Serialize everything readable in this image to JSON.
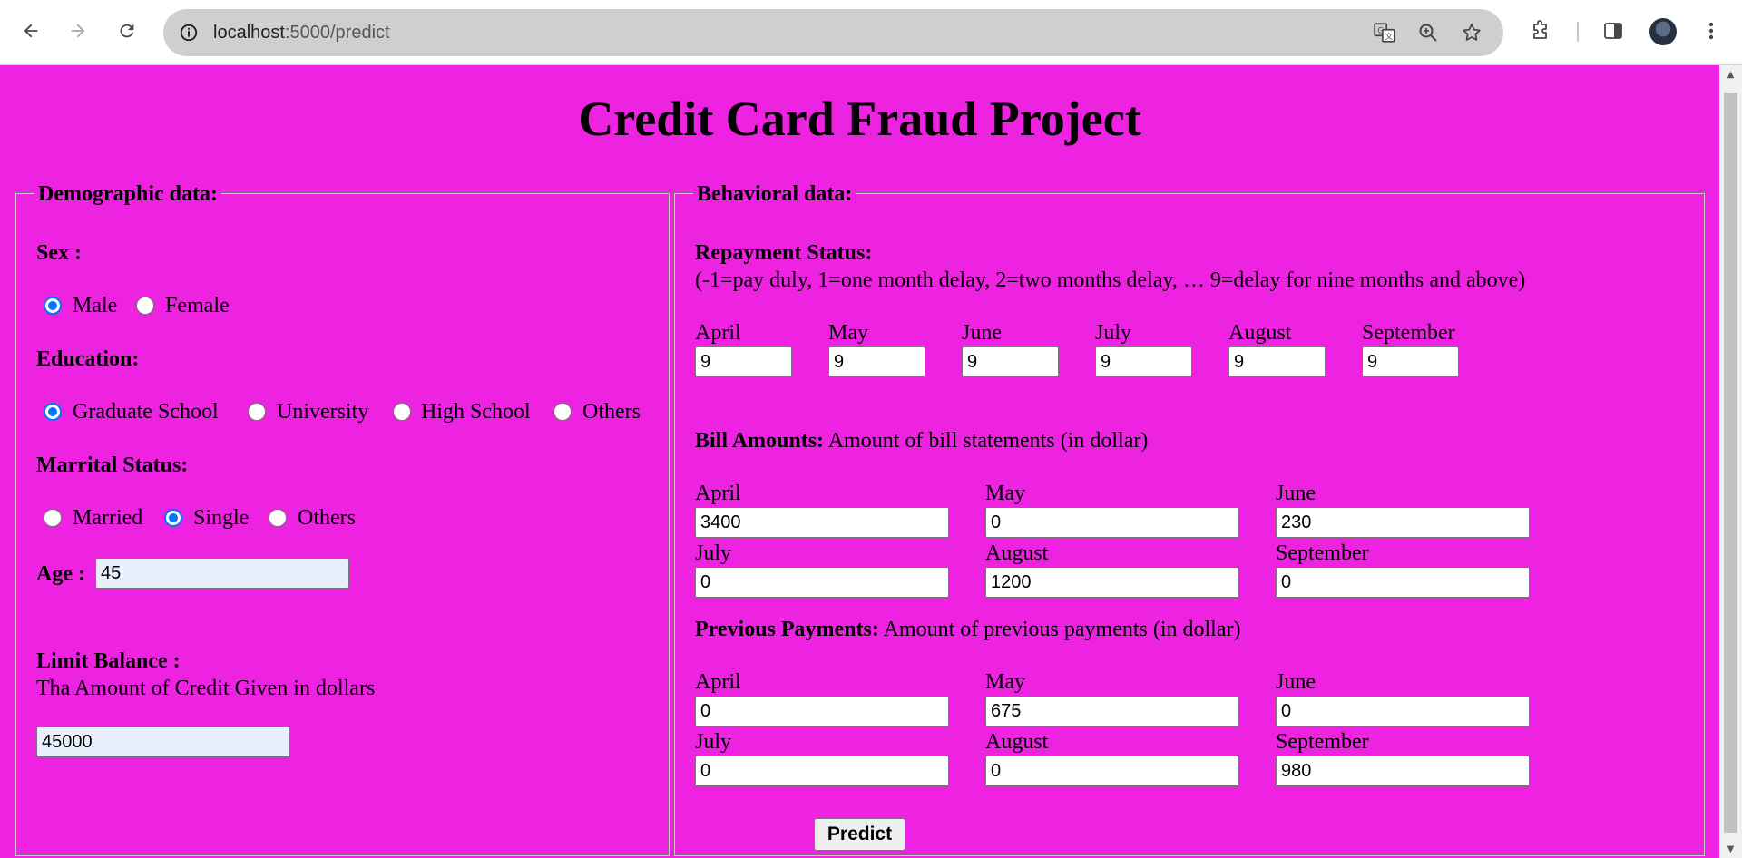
{
  "browser": {
    "url_host": "localhost",
    "url_path": ":5000/predict"
  },
  "page": {
    "title": "Credit Card Fraud Project",
    "predict_label": "Predict"
  },
  "demographic": {
    "legend": "Demographic data:",
    "sex_label": "Sex :",
    "sex_options": [
      "Male",
      "Female"
    ],
    "sex_selected": "Male",
    "education_label": "Education:",
    "education_options": [
      "Graduate School",
      "University",
      "High School",
      "Others"
    ],
    "education_selected": "Graduate School",
    "marital_label": "Marrital Status:",
    "marital_options": [
      "Married",
      "Single",
      "Others"
    ],
    "marital_selected": "Single",
    "age_label": "Age :",
    "age_value": "45",
    "limit_label": "Limit Balance :",
    "limit_desc": "Tha Amount of Credit Given in dollars",
    "limit_value": "45000"
  },
  "behavioral": {
    "legend": "Behavioral data:",
    "repay_label": "Repayment Status:",
    "repay_desc": "(-1=pay duly, 1=one month delay, 2=two months delay, … 9=delay for nine months and above)",
    "repay_fields": [
      {
        "month": "April",
        "value": "9"
      },
      {
        "month": "May",
        "value": "9"
      },
      {
        "month": "June",
        "value": "9"
      },
      {
        "month": "July",
        "value": "9"
      },
      {
        "month": "August",
        "value": "9"
      },
      {
        "month": "September",
        "value": "9"
      }
    ],
    "bill_label": "Bill Amounts:",
    "bill_desc": "Amount of bill statements (in dollar)",
    "bill_fields": [
      {
        "month": "April",
        "value": "3400"
      },
      {
        "month": "May",
        "value": "0"
      },
      {
        "month": "June",
        "value": "230"
      },
      {
        "month": "July",
        "value": "0"
      },
      {
        "month": "August",
        "value": "1200"
      },
      {
        "month": "September",
        "value": "0"
      }
    ],
    "pay_label": "Previous Payments:",
    "pay_desc": "Amount of previous payments (in dollar)",
    "pay_fields": [
      {
        "month": "April",
        "value": "0"
      },
      {
        "month": "May",
        "value": "675"
      },
      {
        "month": "June",
        "value": "0"
      },
      {
        "month": "July",
        "value": "0"
      },
      {
        "month": "August",
        "value": "0"
      },
      {
        "month": "September",
        "value": "980"
      }
    ]
  },
  "colors": {
    "page_background": "#ee22e1",
    "radio_accent": "#0075ff",
    "autofill_background": "#e8f0fe"
  }
}
